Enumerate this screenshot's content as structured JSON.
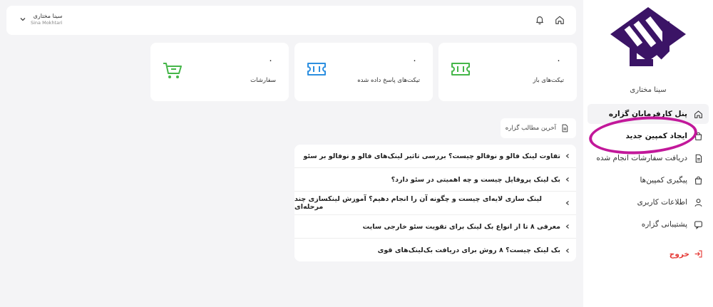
{
  "colors": {
    "brand": "#3b1466",
    "accent_green": "#45b649",
    "accent_blue": "#2d8fe0",
    "highlight": "#c2189a",
    "logout": "#e53935"
  },
  "sidebar": {
    "brand_name": "سینا مختاری",
    "items": [
      {
        "label": "پنل کارفرمایان گزاره",
        "icon": "home-icon"
      },
      {
        "label": "ایجاد کمپین جدید",
        "icon": "bag-icon"
      },
      {
        "label": "دریافت سفارشات انجام شده",
        "icon": "document-icon"
      },
      {
        "label": "پیگیری کمپین‌ها",
        "icon": "bag-icon"
      },
      {
        "label": "اطلاعات کاربری",
        "icon": "user-icon"
      },
      {
        "label": "پشتیبانی گزاره",
        "icon": "chat-icon"
      }
    ],
    "logout": "خروج"
  },
  "header": {
    "user_name_fa": "سینا مختاری",
    "user_name_en": "Sina Mokhtari"
  },
  "stats": [
    {
      "value": "۰",
      "label": "تیکت‌های باز",
      "icon": "ticket-icon"
    },
    {
      "value": "۰",
      "label": "تیکت‌های پاسخ داده شده",
      "icon": "ticket-icon"
    },
    {
      "value": "۰",
      "label": "سفارشات",
      "icon": "cart-icon"
    }
  ],
  "latest": {
    "title": "آخرین مطالب گزاره",
    "posts": [
      "تفاوت لینک فالو و نوفالو چیست؟ بررسی تاثیر لینک‌های فالو و نوفالو بر سئو",
      "بک لینک پروفایل چیست و چه اهمیتی در سئو دارد؟",
      "لینک سازی لایه‌ای چیست و چگونه آن را انجام دهیم؟ آموزش لینکسازی چند مرحله‌ای",
      "معرفی ۸ تا از انواع بک لینک برای تقویت سئو خارجی سایت",
      "بک لینک چیست؟ ۸ روش برای دریافت بک‌لینک‌های قوی"
    ]
  }
}
